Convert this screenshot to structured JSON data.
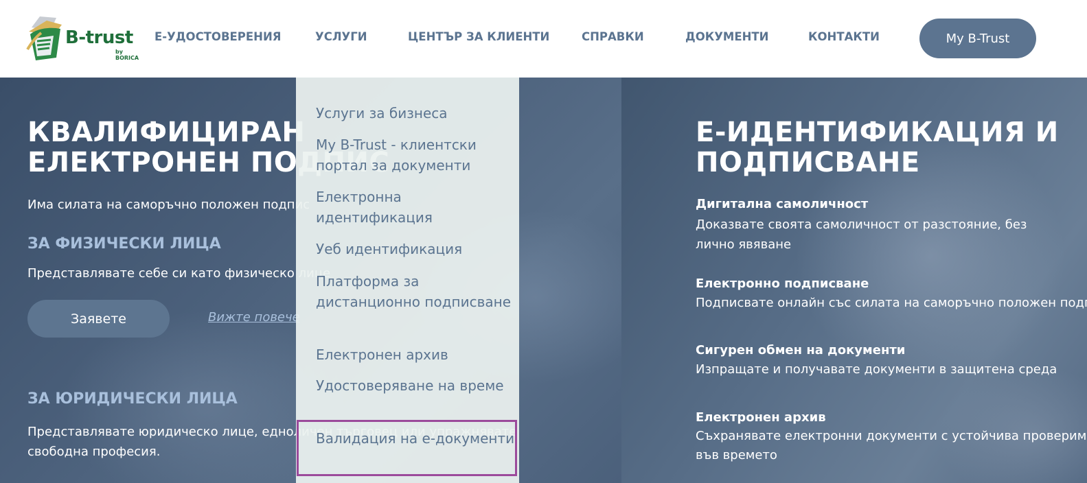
{
  "header": {
    "logo": {
      "brand": "B-trust",
      "sub": "by BORICA"
    },
    "nav": [
      {
        "label": "Е-УДОСТОВЕРЕНИЯ"
      },
      {
        "label": "УСЛУГИ"
      },
      {
        "label": "ЦЕНТЪР ЗА КЛИЕНТИ"
      },
      {
        "label": "СПРАВКИ"
      },
      {
        "label": "ДОКУМЕНТИ"
      },
      {
        "label": "КОНТАКТИ"
      }
    ],
    "account_button": "My B-Trust"
  },
  "dropdown": {
    "items": [
      {
        "label": "Услуги за бизнеса"
      },
      {
        "label": "My B-Trust - клиентски портал за документи"
      },
      {
        "label": "Електронна идентификация"
      },
      {
        "label": "Уеб идентификация"
      },
      {
        "label": "Платформа за дистанционно подписване"
      },
      {
        "label": "Електронен архив"
      },
      {
        "label": "Удостоверяване на време"
      },
      {
        "label": "Валидация на е-документи"
      }
    ],
    "highlighted": "Валидация на е-документи"
  },
  "left_panel": {
    "title": "КВАЛИФИЦИРАН ЕЛЕКТРОНЕН ПОДПИС",
    "subtitle": "Има силата на саморъчно положен подпис",
    "individuals_heading": "ЗА ФИЗИЧЕСКИ ЛИЦА",
    "individuals_text": "Представлявате себе си като физическо лице",
    "apply_button": "Заявете",
    "more_link": "Вижте повече",
    "legal_heading": "ЗА ЮРИДИЧЕСКИ ЛИЦА",
    "legal_text_1": "Представлявате юридическо лице, едноличен търговец или упражнявате",
    "legal_text_2": "свободна професия."
  },
  "right_panel": {
    "title": "Е-ИДЕНТИФИКАЦИЯ И ПОДПИСВАНЕ",
    "features": [
      {
        "title": "Дигитална самоличност",
        "text": [
          "Доказвате своята самоличност от разстояние, без",
          "лично явяване"
        ]
      },
      {
        "title": "Електронно подписване",
        "text": [
          "Подписвате онлайн със силата на саморъчно положен подпис"
        ]
      },
      {
        "title": "Сигурен обмен на документи",
        "text": [
          "Изпращате и получавате документи в защитена среда"
        ]
      },
      {
        "title": "Електронен архив",
        "text": [
          "Съхранявате електронни документи с устойчива проверимост",
          "във времето"
        ]
      }
    ]
  },
  "colors": {
    "nav_text": "#5b7490",
    "button_bg": "#5c7490",
    "brand_green": "#1f6f3a",
    "highlight_border": "#9b4a9b",
    "heading_accent": "#a9c0dc"
  }
}
